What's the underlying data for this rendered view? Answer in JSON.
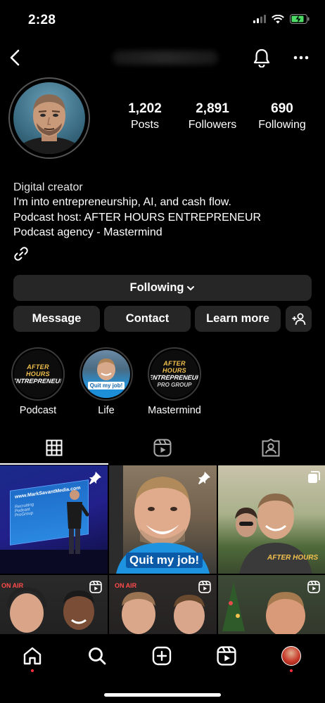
{
  "status_bar": {
    "time": "2:28"
  },
  "profile": {
    "stats": [
      {
        "value": "1,202",
        "label": "Posts"
      },
      {
        "value": "2,891",
        "label": "Followers"
      },
      {
        "value": "690",
        "label": "Following"
      }
    ],
    "bio": {
      "category": "Digital creator",
      "lines": [
        "I'm into entrepreneurship, AI, and cash flow.",
        "Podcast host: AFTER HOURS ENTREPRENEUR",
        "Podcast agency - Mastermind"
      ]
    }
  },
  "actions": {
    "following": "Following",
    "message": "Message",
    "contact": "Contact",
    "learn_more": "Learn more"
  },
  "highlights": [
    {
      "label": "Podcast",
      "logo_top": "AFTER HOURS",
      "logo_bottom": "ENTREPRENEUR"
    },
    {
      "label": "Life",
      "badge_text": "Quit my job!"
    },
    {
      "label": "Mastermind",
      "logo_top": "AFTER HOURS",
      "logo_bottom": "ENTREPRENEUR",
      "logo_sub": "PRO GROUP"
    }
  ],
  "posts": {
    "cell1_screen_title": "www.MarkSavantMedia.com",
    "cell1_lines": [
      "Recruiting",
      "Podcast",
      "ProGroup"
    ],
    "cell2_shirt_text": "Quit my job!",
    "cell3_shirt_text": "AFTER HOURS",
    "cell4_sign": "ON AIR",
    "cell5_sign": "ON AIR"
  },
  "tabs": [
    {
      "name": "grid",
      "icon": "grid-icon",
      "active": true
    },
    {
      "name": "reels",
      "icon": "reels-icon",
      "active": false
    },
    {
      "name": "tagged",
      "icon": "tagged-icon",
      "active": false
    }
  ],
  "bottom_nav": [
    "home-icon",
    "search-icon",
    "create-icon",
    "reels-icon",
    "profile-avatar"
  ],
  "colors": {
    "background": "#000000",
    "button": "#262626",
    "notify_dot": "#ff3040",
    "battery": "#4cd964"
  }
}
